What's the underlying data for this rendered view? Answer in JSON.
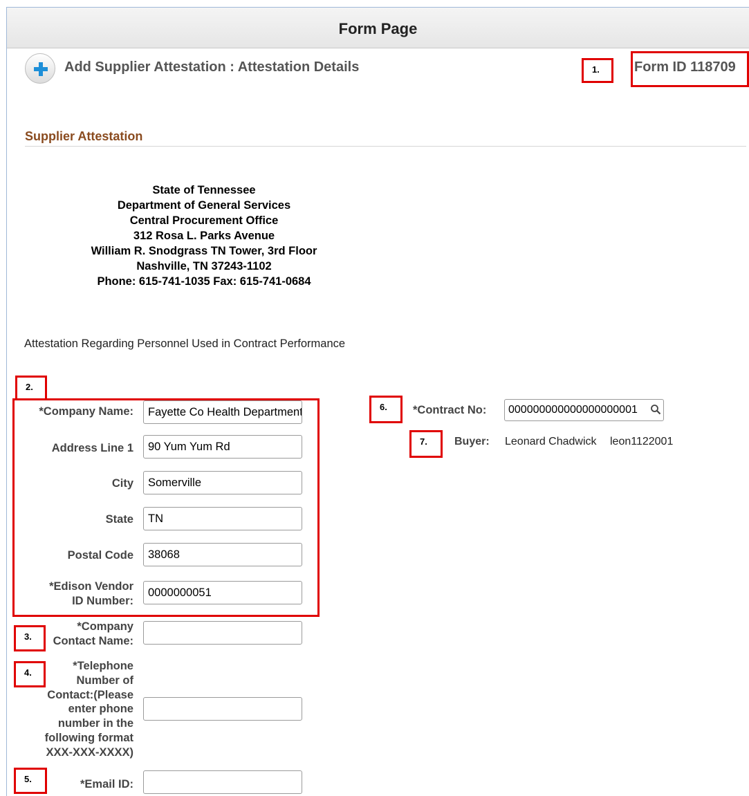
{
  "header": {
    "title": "Form Page"
  },
  "page": {
    "heading": "Add Supplier Attestation :  Attestation Details",
    "form_id": "Form ID 118709"
  },
  "section": {
    "title": "Supplier Attestation"
  },
  "address_block": [
    "State of Tennessee",
    "Department of General Services",
    "Central Procurement Office",
    "312 Rosa L. Parks Avenue",
    "William R. Snodgrass TN Tower, 3rd Floor",
    "Nashville, TN 37243-1102",
    "Phone: 615-741-1035 Fax: 615-741-0684"
  ],
  "intro_text": "Attestation Regarding Personnel Used in Contract Performance",
  "fields": {
    "company_name": {
      "label": "*Company Name:",
      "value": "Fayette Co Health Department"
    },
    "address_line1": {
      "label": "Address Line 1",
      "value": "90 Yum Yum Rd"
    },
    "city": {
      "label": "City",
      "value": "Somerville"
    },
    "state": {
      "label": "State",
      "value": "TN"
    },
    "postal_code": {
      "label": "Postal Code",
      "value": "38068"
    },
    "vendor_id": {
      "label_line1": "*Edison Vendor",
      "label_line2": "ID Number:",
      "value": "0000000051"
    },
    "contact_name": {
      "label_line1": "*Company",
      "label_line2": "Contact Name:",
      "value": ""
    },
    "telephone": {
      "label_lines": [
        "*Telephone",
        "Number of",
        "Contact:(Please",
        "enter phone",
        "number in the",
        "following format",
        "XXX-XXX-XXXX)"
      ],
      "value": ""
    },
    "email": {
      "label": "*Email ID:",
      "value": ""
    },
    "contract_no": {
      "label": "*Contract No:",
      "value": "000000000000000000001"
    }
  },
  "buyer": {
    "label": "Buyer:",
    "name": "Leonard Chadwick",
    "id": "leon1122001"
  },
  "annotations": [
    "1.",
    "2.",
    "3.",
    "4.",
    "5.",
    "6.",
    "7."
  ],
  "icons": {
    "add": "plus-icon",
    "lookup": "magnifier-icon"
  },
  "colors": {
    "annotation_red": "#e00000",
    "section_title": "#8a4b1f",
    "plus_blue": "#1e8fd8"
  }
}
